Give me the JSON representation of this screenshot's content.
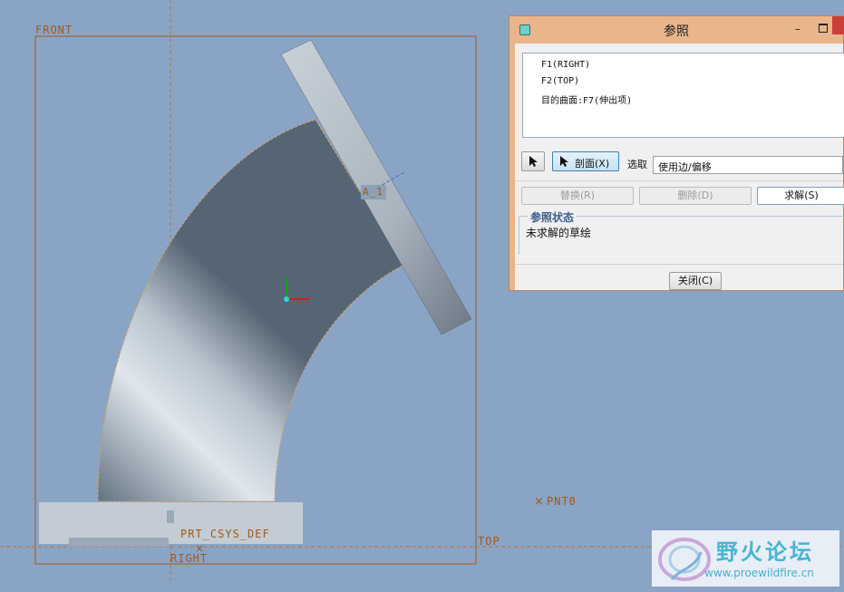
{
  "viewport": {
    "datums": {
      "front": "FRONT",
      "top": "TOP",
      "right": "RIGHT",
      "csys": "PRT_CSYS_DEF",
      "point": "PNT0",
      "axis": "A_1"
    },
    "colors": {
      "background": "#8aa4c6",
      "datum": "#a05a1a",
      "part": "#c3ccd4"
    }
  },
  "dialog": {
    "title": "参照",
    "references": [
      "F1(RIGHT)",
      "F2(TOP)",
      "目的曲面:F7(伸出项)"
    ],
    "arrow_icon": "arrow-cursor-icon",
    "section_label": "剖面(X)",
    "select_label": "选取",
    "select_value": "使用边/偏移",
    "replace_label": "替换(R)",
    "delete_label": "删除(D)",
    "solve_label": "求解(S)",
    "status_title": "参照状态",
    "status_text": "未求解的草绘",
    "close_label": "关闭(C)"
  },
  "watermark": {
    "name": "野火论坛",
    "url": "www.proewildfire.cn"
  }
}
